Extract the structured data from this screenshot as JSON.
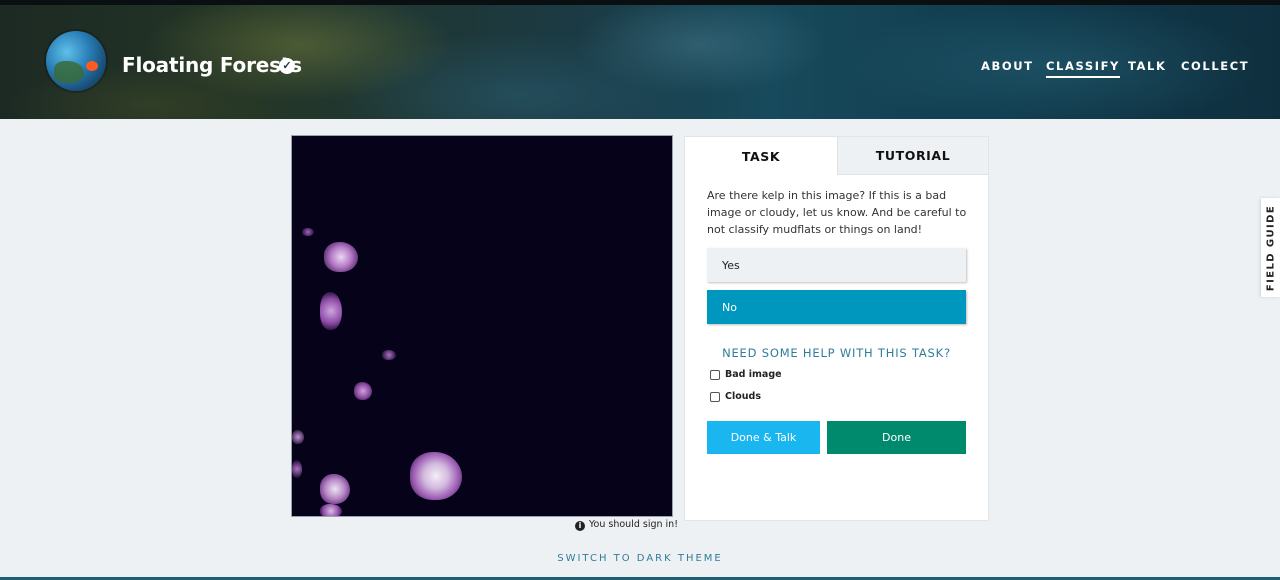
{
  "header": {
    "project_title": "Floating Forests",
    "verified_icon": "verified-check-icon",
    "nav": [
      "ABOUT",
      "CLASSIFY",
      "TALK",
      "COLLECT"
    ],
    "active_nav": "CLASSIFY"
  },
  "subject": {
    "sign_in_notice": "You should sign in!",
    "info_icon": "info-icon"
  },
  "task_panel": {
    "tabs": [
      "TASK",
      "TUTORIAL"
    ],
    "active_tab": "TASK",
    "question": "Are there kelp in this image? If this is a bad image or cloudy, let us know. And be careful to not classify mudflats or things on land!",
    "answers": [
      "Yes",
      "No"
    ],
    "selected_answer": "No",
    "help_link": "NEED SOME HELP WITH THIS TASK?",
    "checkboxes": [
      {
        "label": "Bad image",
        "checked": false
      },
      {
        "label": "Clouds",
        "checked": false
      }
    ],
    "buttons": {
      "done_talk": "Done & Talk",
      "done": "Done"
    }
  },
  "field_guide": "FIELD GUIDE",
  "footer": {
    "theme_toggle": "SWITCH TO DARK THEME"
  },
  "colors": {
    "selected_answer": "#0097bf",
    "done_talk": "#1ab6f0",
    "done": "#008a6d",
    "link": "#2f7d9a"
  }
}
